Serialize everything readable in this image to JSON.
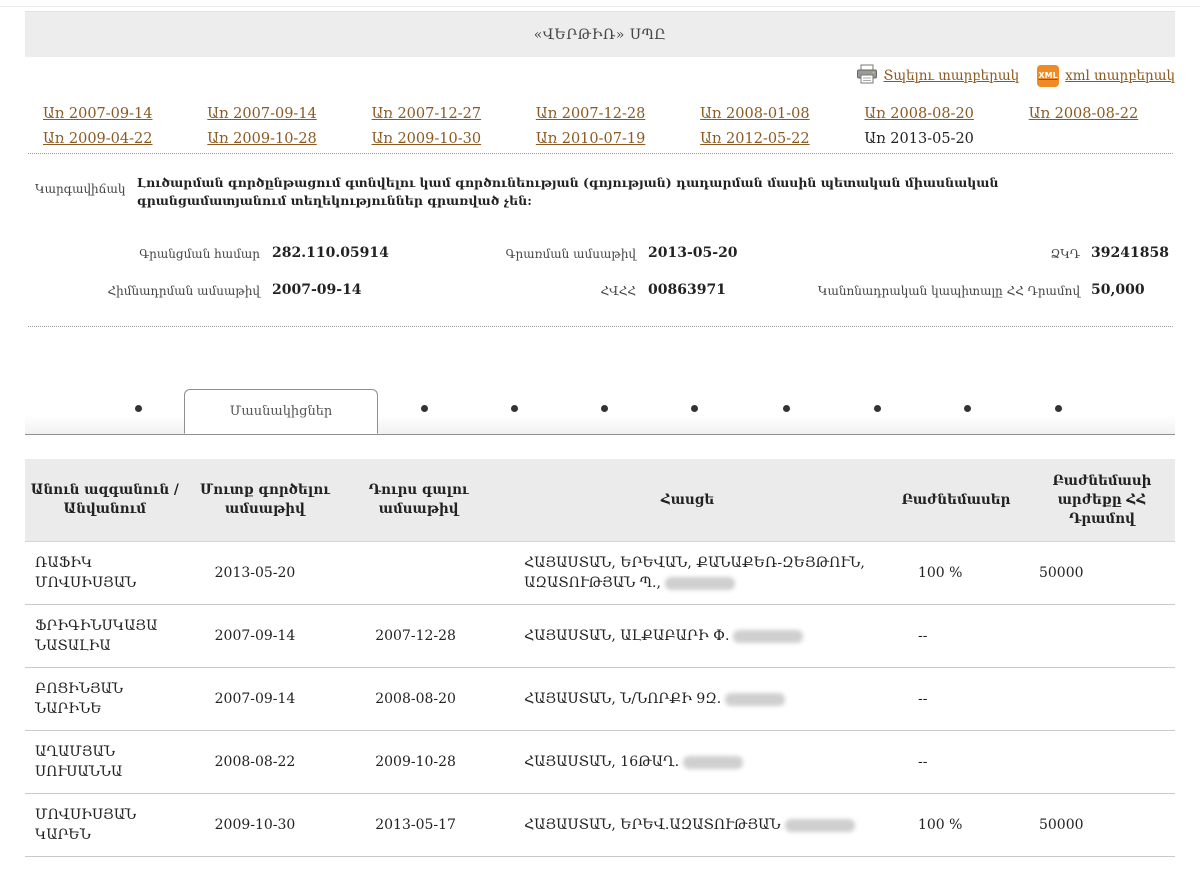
{
  "company": {
    "name": "«ՎԵՐԹԻՌ» ՍՊԸ"
  },
  "actions": {
    "print_label": "Տպելու տարբերակ",
    "xml_label": "xml տարբերակ",
    "xml_icon_text": "XML"
  },
  "versions": [
    "Առ 2007-09-14",
    "Առ 2007-09-14",
    "Առ 2007-12-27",
    "Առ 2007-12-28",
    "Առ 2008-01-08",
    "Առ 2008-08-20",
    "Առ 2008-08-22",
    "Առ 2009-04-22",
    "Առ 2009-10-28",
    "Առ 2009-10-30",
    "Առ 2010-07-19",
    "Առ 2012-05-22",
    "Առ 2013-05-20"
  ],
  "status": {
    "label": "Կարգավիճակ",
    "text": "Լուծարման գործընթացում գտնվելու կամ գործունեության (գոյության) դադարման մասին պետական միասնական գրանցամատյանում տեղեկություններ գրառված չեն:"
  },
  "info": {
    "reg_number_label": "Գրանցման համար",
    "reg_number": "282.110.05914",
    "record_date_label": "Գրառման ամսաթիվ",
    "record_date": "2013-05-20",
    "code_label": "ՁԿԴ",
    "code": "39241858",
    "founded_label": "Հիմնադրման ամսաթիվ",
    "founded": "2007-09-14",
    "tin_label": "ՀՎՀՀ",
    "tin": "00863971",
    "capital_label": "Կանոնադրական կապիտալը ՀՀ Դրամով",
    "capital": "50,000"
  },
  "tabs": {
    "active_label": "Մասնակիցներ",
    "dot_count": 9
  },
  "table": {
    "headers": [
      "Անուն ազգանուն / Անվանում",
      "Մուտք գործելու ամսաթիվ",
      "Դուրս գալու ամսաթիվ",
      "Հասցե",
      "Բաժնեմասեր",
      "Բաժնեմասի արժեքը ՀՀ Դրամով"
    ],
    "rows": [
      {
        "name": "ՌԱՖԻԿ ՄՈՎՍԻՍՅԱՆ",
        "entry": "2013-05-20",
        "exit": "",
        "address": "ՀԱՅԱՍՏԱՆ, ԵՐԵՎԱՆ, ՔԱՆԱՔԵՌ-ԶԵՅԹՈՒՆ, ԱԶԱՏՈՒԹՅԱՆ Պ.,",
        "share": "100 %",
        "value": "50000"
      },
      {
        "name": "ՖՐԻԳԻՆՍԿԱՅԱ ՆԱՏԱԼԻԱ",
        "entry": "2007-09-14",
        "exit": "2007-12-28",
        "address": "ՀԱՅԱՍՏԱՆ, ԱԼՔԱԲԱՐԻ Փ.",
        "share": "--",
        "value": ""
      },
      {
        "name": "ԲՈՑԻՆՅԱՆ ՆԱՐԻՆԵ",
        "entry": "2007-09-14",
        "exit": "2008-08-20",
        "address": "ՀԱՅԱՍՏԱՆ, Ն/ՆՈՐՔԻ 9Զ.",
        "share": "--",
        "value": ""
      },
      {
        "name": "ԱՂԱՄՅԱՆ ՍՈՒՍԱՆՆԱ",
        "entry": "2008-08-22",
        "exit": "2009-10-28",
        "address": "ՀԱՅԱՍՏԱՆ, 16ԹԱՂ.",
        "share": "--",
        "value": ""
      },
      {
        "name": "ՄՈՎՍԻՍՅԱՆ ԿԱՐԵՆ",
        "entry": "2009-10-30",
        "exit": "2013-05-17",
        "address": "ՀԱՅԱՍՏԱՆ, ԵՐԵՎ.ԱԶԱՏՈՒԹՅԱՆ",
        "share": "100 %",
        "value": "50000"
      }
    ]
  }
}
